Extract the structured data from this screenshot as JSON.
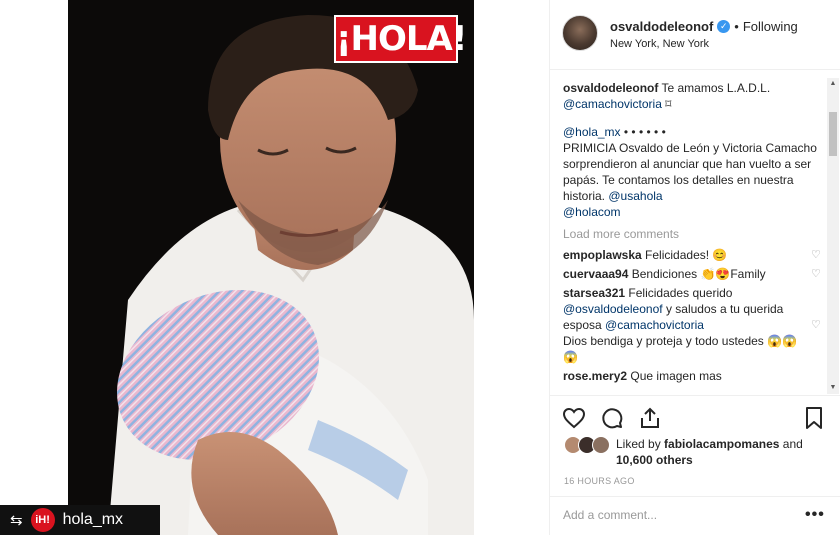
{
  "post": {
    "overlay_logo": "¡HOLA!",
    "repost_logo": "iH!",
    "repost_handle": "hola_mx"
  },
  "header": {
    "username": "osvaldodeleonof",
    "separator": "•",
    "follow_status": "Following",
    "location": "New York, New York"
  },
  "caption": {
    "username": "osvaldodeleonof",
    "text": "Te amamos L.A.D.L.",
    "mention": "@camachovictoria",
    "emoji": "⌑"
  },
  "repost_text": {
    "handle": "@hola_mx",
    "dots": "• • • • • •",
    "body": "PRIMICIA Osvaldo de León y Victoria Camacho sorprendieron al anunciar que han vuelto a ser papás. Te contamos los detalles en nuestra historia.",
    "mention1": "@usahola",
    "mention2": "@holacom"
  },
  "load_more": "Load more comments",
  "comments": [
    {
      "user": "empoplawska",
      "text": "Felicidades! 😊"
    },
    {
      "user": "cuervaaa94",
      "text": "Bendiciones 👏😍Family"
    },
    {
      "user": "starsea321",
      "text": "Felicidades querido",
      "mention": "@osvaldodeleonof",
      "text2": "y saludos a tu querida esposa",
      "mention2": "@camachovictoria",
      "text3": "Dios bendiga y proteja y todo ustedes 😱😱😱"
    },
    {
      "user": "rose.mery2",
      "text": "Que imagen mas"
    }
  ],
  "likes": {
    "prefix": "Liked by",
    "user": "fabiolacampomanes",
    "middle": "and",
    "count": "10,600 others"
  },
  "timestamp": "16 HOURS AGO",
  "add_comment": {
    "placeholder": "Add a comment..."
  },
  "more_label": "•••",
  "icons": {
    "verified": "verified-badge-icon",
    "heart": "heart-icon",
    "comment": "comment-icon",
    "share": "share-icon",
    "bookmark": "bookmark-icon",
    "repost": "repost-icon",
    "more": "more-options-icon"
  },
  "colors": {
    "accent_link": "#003569",
    "verified_blue": "#3897f0",
    "hola_red": "#d9131f",
    "muted": "#999999"
  }
}
